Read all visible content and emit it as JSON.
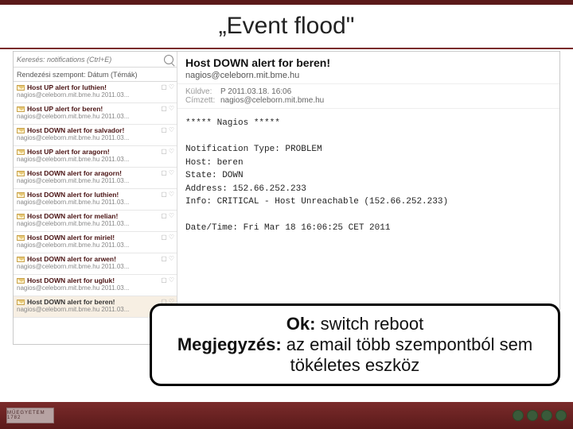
{
  "title": "„Event flood\"",
  "search": {
    "placeholder": "Keresés: notifications (Ctrl+E)"
  },
  "sort": {
    "label": "Rendezési szempont: Dátum (Témák)"
  },
  "messages": [
    {
      "subject": "Host UP alert for luthien!",
      "from": "nagios@celeborn.mit.bme.hu  2011.03..."
    },
    {
      "subject": "Host UP alert for beren!",
      "from": "nagios@celeborn.mit.bme.hu  2011.03..."
    },
    {
      "subject": "Host DOWN alert for salvador!",
      "from": "nagios@celeborn.mit.bme.hu  2011.03..."
    },
    {
      "subject": "Host UP alert for aragorn!",
      "from": "nagios@celeborn.mit.bme.hu  2011.03..."
    },
    {
      "subject": "Host DOWN alert for aragorn!",
      "from": "nagios@celeborn.mit.bme.hu  2011.03..."
    },
    {
      "subject": "Host DOWN alert for luthien!",
      "from": "nagios@celeborn.mit.bme.hu  2011.03..."
    },
    {
      "subject": "Host DOWN alert for melian!",
      "from": "nagios@celeborn.mit.bme.hu  2011.03..."
    },
    {
      "subject": "Host DOWN alert for miriel!",
      "from": "nagios@celeborn.mit.bme.hu  2011.03..."
    },
    {
      "subject": "Host DOWN alert for arwen!",
      "from": "nagios@celeborn.mit.bme.hu  2011.03..."
    },
    {
      "subject": "Host DOWN alert for ugluk!",
      "from": "nagios@celeborn.mit.bme.hu  2011.03..."
    },
    {
      "subject": "Host DOWN alert for beren!",
      "from": "nagios@celeborn.mit.bme.hu  2011.03..."
    }
  ],
  "preview": {
    "subject": "Host DOWN alert for beren!",
    "from": "nagios@celeborn.mit.bme.hu",
    "sentLabel": "Küldve:",
    "sent": "P 2011.03.18. 16:06",
    "toLabel": "Címzett:",
    "to": "nagios@celeborn.mit.bme.hu",
    "body": "***** Nagios *****\n\nNotification Type: PROBLEM\nHost: beren\nState: DOWN\nAddress: 152.66.252.233\nInfo: CRITICAL - Host Unreachable (152.66.252.233)\n\nDate/Time: Fri Mar 18 16:06:25 CET 2011"
  },
  "callout": {
    "line1_label": "Ok:",
    "line1_text": " switch reboot",
    "line2_label": "Megjegyzés:",
    "line2_text": " az email több szempontból sem tökéletes eszköz"
  },
  "logo": "MŰEGYETEM 1782"
}
